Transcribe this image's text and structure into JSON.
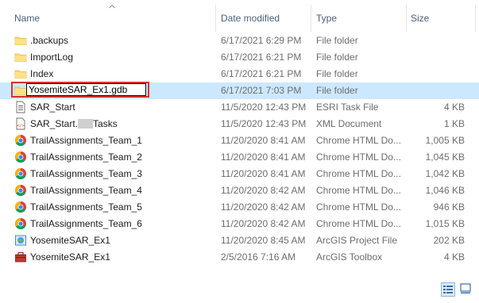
{
  "columns": {
    "name": "Name",
    "date_modified": "Date modified",
    "type": "Type",
    "size": "Size"
  },
  "rename_value": "YosemiteSAR_Ex1.gdb",
  "rows": [
    {
      "icon": "folder-icon",
      "name": ".backups",
      "date": "6/17/2021 6:29 PM",
      "type": "File folder",
      "size": ""
    },
    {
      "icon": "folder-icon",
      "name": "ImportLog",
      "date": "6/17/2021 6:21 PM",
      "type": "File folder",
      "size": ""
    },
    {
      "icon": "folder-icon",
      "name": "Index",
      "date": "6/17/2021 6:21 PM",
      "type": "File folder",
      "size": ""
    },
    {
      "icon": "folder-icon",
      "name": "YosemiteSAR_Ex1.gdb",
      "date": "6/17/2021 7:03 PM",
      "type": "File folder",
      "size": "",
      "selected": true,
      "renaming": true
    },
    {
      "icon": "esri-task-file-icon",
      "name": "SAR_Start",
      "date": "11/5/2020 12:43 PM",
      "type": "ESRI Task File",
      "size": "4 KB"
    },
    {
      "icon": "xml-document-icon",
      "name_prefix": "SAR_Start.",
      "name_suffix": "Tasks",
      "date": "11/5/2020 12:43 PM",
      "type": "XML Document",
      "size": "1 KB"
    },
    {
      "icon": "chrome-icon",
      "name": "TrailAssignments_Team_1",
      "date": "11/20/2020 8:41 AM",
      "type": "Chrome HTML Do...",
      "size": "1,005 KB"
    },
    {
      "icon": "chrome-icon",
      "name": "TrailAssignments_Team_2",
      "date": "11/20/2020 8:41 AM",
      "type": "Chrome HTML Do...",
      "size": "1,045 KB"
    },
    {
      "icon": "chrome-icon",
      "name": "TrailAssignments_Team_3",
      "date": "11/20/2020 8:41 AM",
      "type": "Chrome HTML Do...",
      "size": "1,042 KB"
    },
    {
      "icon": "chrome-icon",
      "name": "TrailAssignments_Team_4",
      "date": "11/20/2020 8:42 AM",
      "type": "Chrome HTML Do...",
      "size": "1,046 KB"
    },
    {
      "icon": "chrome-icon",
      "name": "TrailAssignments_Team_5",
      "date": "11/20/2020 8:42 AM",
      "type": "Chrome HTML Do...",
      "size": "946 KB"
    },
    {
      "icon": "chrome-icon",
      "name": "TrailAssignments_Team_6",
      "date": "11/20/2020 8:42 AM",
      "type": "Chrome HTML Do...",
      "size": "1,015 KB"
    },
    {
      "icon": "arcgis-project-icon",
      "name": "YosemiteSAR_Ex1",
      "date": "11/20/2020 8:45 AM",
      "type": "ArcGIS Project File",
      "size": "202 KB"
    },
    {
      "icon": "arcgis-toolbox-icon",
      "name": "YosemiteSAR_Ex1",
      "date": "2/5/2016 7:16 AM",
      "type": "ArcGIS Toolbox",
      "size": "4 KB"
    }
  ],
  "view_buttons": {
    "details": "details-view-icon",
    "tiles": "large-icons-view-icon"
  }
}
